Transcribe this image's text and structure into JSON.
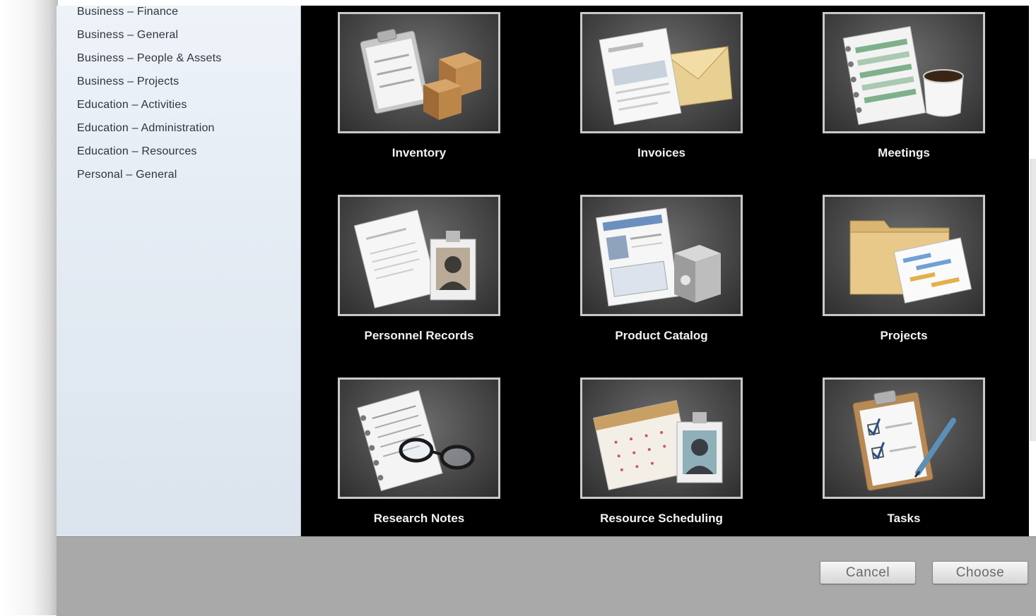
{
  "sidebar": {
    "items": [
      {
        "label": "Business – Finance"
      },
      {
        "label": "Business – General"
      },
      {
        "label": "Business – People & Assets"
      },
      {
        "label": "Business – Projects"
      },
      {
        "label": "Education – Activities"
      },
      {
        "label": "Education – Administration"
      },
      {
        "label": "Education – Resources"
      },
      {
        "label": "Personal – General"
      }
    ]
  },
  "templates": [
    {
      "label": "Inventory",
      "icon": "clipboard-boxes-icon"
    },
    {
      "label": "Invoices",
      "icon": "invoice-envelope-icon"
    },
    {
      "label": "Meetings",
      "icon": "notebook-coffee-icon"
    },
    {
      "label": "Personnel Records",
      "icon": "document-id-badge-icon"
    },
    {
      "label": "Product Catalog",
      "icon": "catalog-box-icon"
    },
    {
      "label": "Projects",
      "icon": "folder-chart-icon"
    },
    {
      "label": "Research Notes",
      "icon": "notebook-glasses-icon"
    },
    {
      "label": "Resource Scheduling",
      "icon": "calendar-badge-icon"
    },
    {
      "label": "Tasks",
      "icon": "clipboard-checklist-pen-icon"
    }
  ],
  "footer": {
    "cancel_label": "Cancel",
    "choose_label": "Choose"
  }
}
